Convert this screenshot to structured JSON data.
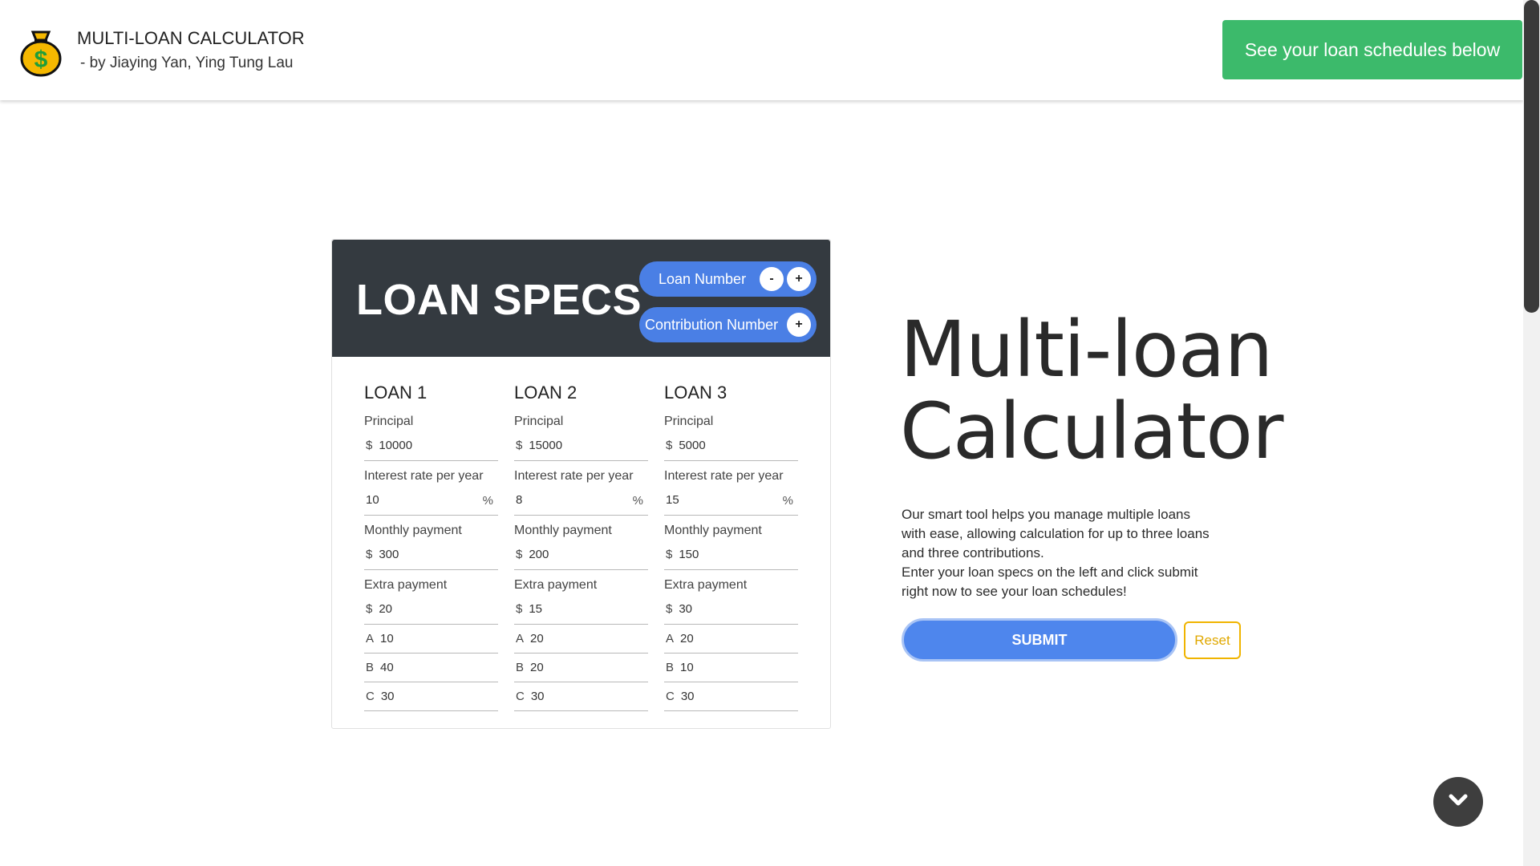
{
  "header": {
    "title": "MULTI-LOAN CALCULATOR",
    "subtitle": "- by Jiaying Yan, Ying Tung Lau",
    "schedule_button": "See your loan schedules below"
  },
  "card": {
    "title": "LOAN SPECS",
    "loan_number_label": "Loan Number",
    "minus": "-",
    "plus": "+",
    "contribution_label": "Contribution Number",
    "loans": [
      {
        "title": "LOAN 1",
        "principal_label": "Principal",
        "principal": "10000",
        "rate_label": "Interest rate per year",
        "rate": "10",
        "monthly_label": "Monthly payment",
        "monthly": "300",
        "extra_label": "Extra payment",
        "extra": "20",
        "a": "10",
        "b": "40",
        "c": "30"
      },
      {
        "title": "LOAN 2",
        "principal_label": "Principal",
        "principal": "15000",
        "rate_label": "Interest rate per year",
        "rate": "8",
        "monthly_label": "Monthly payment",
        "monthly": "200",
        "extra_label": "Extra payment",
        "extra": "15",
        "a": "20",
        "b": "20",
        "c": "30"
      },
      {
        "title": "LOAN 3",
        "principal_label": "Principal",
        "principal": "5000",
        "rate_label": "Interest rate per year",
        "rate": "15",
        "monthly_label": "Monthly payment",
        "monthly": "150",
        "extra_label": "Extra payment",
        "extra": "30",
        "a": "20",
        "b": "10",
        "c": "30"
      }
    ],
    "currency": "$",
    "percent": "%",
    "contrib_a": "A",
    "contrib_b": "B",
    "contrib_c": "C"
  },
  "hero": {
    "line1": "Multi-loan",
    "line2": "Calculator",
    "desc1": "Our smart tool helps you manage multiple loans with ease, allowing calculation for up to three loans and three contributions.",
    "desc2": "Enter your loan specs on the left and click submit right now to see your loan schedules!",
    "submit": "SUBMIT",
    "reset": "Reset"
  },
  "icons": {
    "logo": "money-bag-icon",
    "scroll_down": "chevron-down-icon"
  },
  "colors": {
    "green": "#3cba6b",
    "blue": "#4e86ed",
    "dark": "#343a40",
    "reset": "#f0b400"
  }
}
